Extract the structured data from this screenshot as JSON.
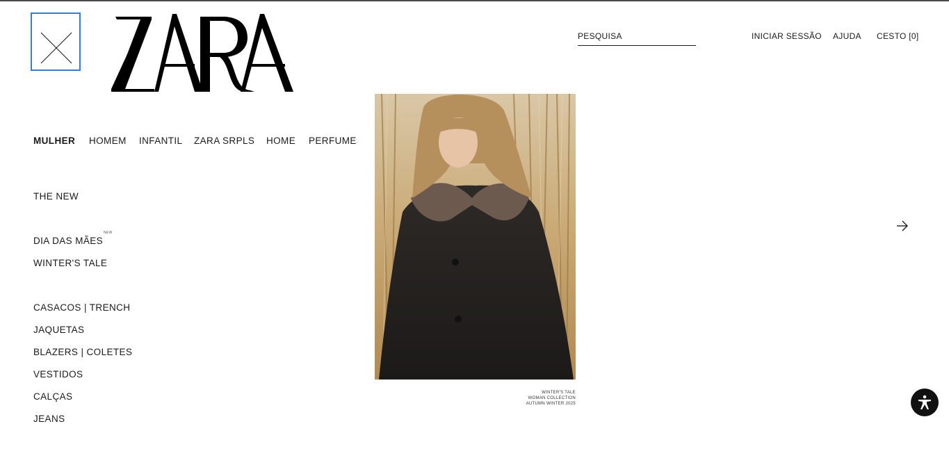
{
  "header": {
    "close_icon": "close-icon",
    "logo_text": "ZARA",
    "search_label": "PESQUISA",
    "login_label": "INICIAR SESSÃO",
    "help_label": "AJUDA",
    "cart_label": "CESTO [0]"
  },
  "nav": {
    "tabs": [
      {
        "label": "MULHER",
        "active": true
      },
      {
        "label": "HOMEM"
      },
      {
        "label": "INFANTIL"
      },
      {
        "label": "ZARA SRPLS"
      },
      {
        "label": "HOME"
      },
      {
        "label": "PERFUMES"
      }
    ]
  },
  "menu": {
    "items": [
      {
        "label": "THE NEW"
      },
      {
        "label": "DIA DAS MÃES",
        "tag": "NEW"
      },
      {
        "label": "WINTER'S TALE"
      },
      {
        "label": "CASACOS | TRENCH"
      },
      {
        "label": "JAQUETAS"
      },
      {
        "label": "BLAZERS | COLETES"
      },
      {
        "label": "VESTIDOS"
      },
      {
        "label": "CALÇAS"
      },
      {
        "label": "JEANS"
      }
    ]
  },
  "hero": {
    "caption_lines": [
      "WINTER'S TALE",
      "WOMAN COLLECTION",
      "AUTUMN WINTER 2025"
    ]
  },
  "icons": {
    "next": "arrow-right-icon",
    "accessibility": "accessibility-icon"
  }
}
